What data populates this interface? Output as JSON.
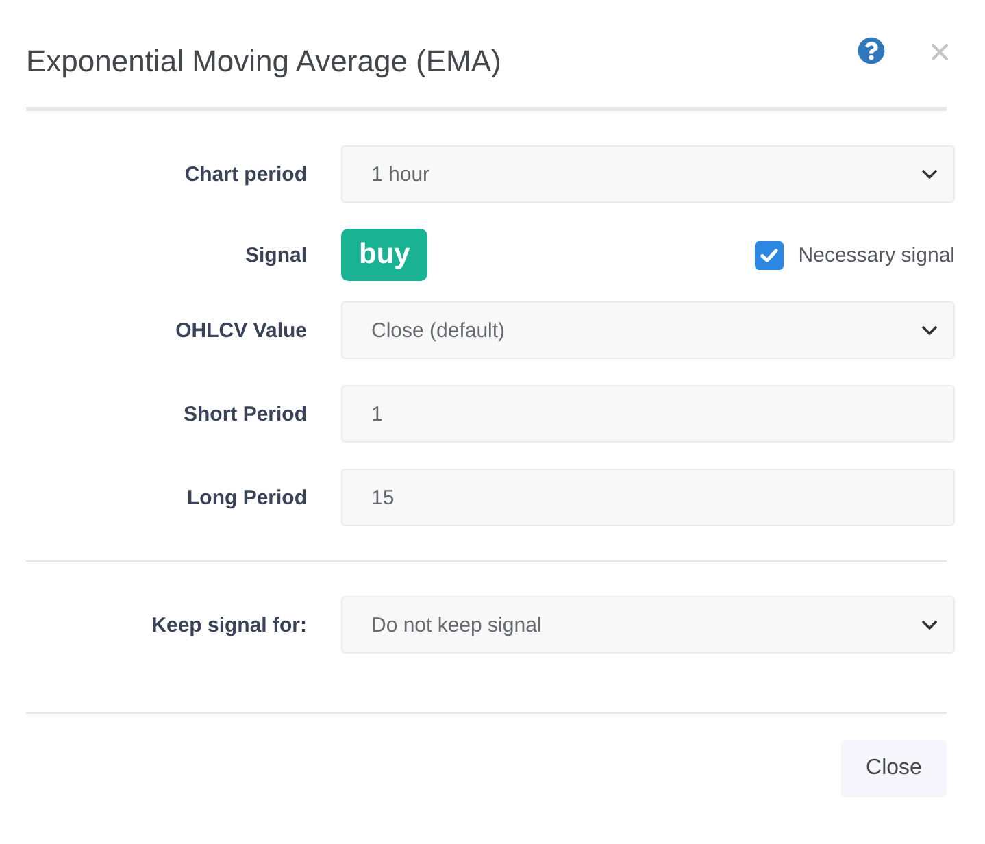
{
  "dialog": {
    "title": "Exponential Moving Average (EMA)"
  },
  "sections": [
    {
      "fields": [
        {
          "kind": "select",
          "label": "Chart period",
          "value": "1 hour"
        },
        {
          "kind": "signal",
          "label": "Signal",
          "signal": "buy",
          "checkbox": {
            "label": "Necessary signal",
            "checked": true
          }
        },
        {
          "kind": "select",
          "label": "OHLCV Value",
          "value": "Close (default)"
        },
        {
          "kind": "input",
          "label": "Short Period",
          "value": "1"
        },
        {
          "kind": "input",
          "label": "Long Period",
          "value": "15"
        }
      ]
    },
    {
      "fields": [
        {
          "kind": "select",
          "label": "Keep signal for:",
          "value": "Do not keep signal"
        }
      ]
    }
  ],
  "buttons": [
    {
      "label": "Close"
    }
  ]
}
